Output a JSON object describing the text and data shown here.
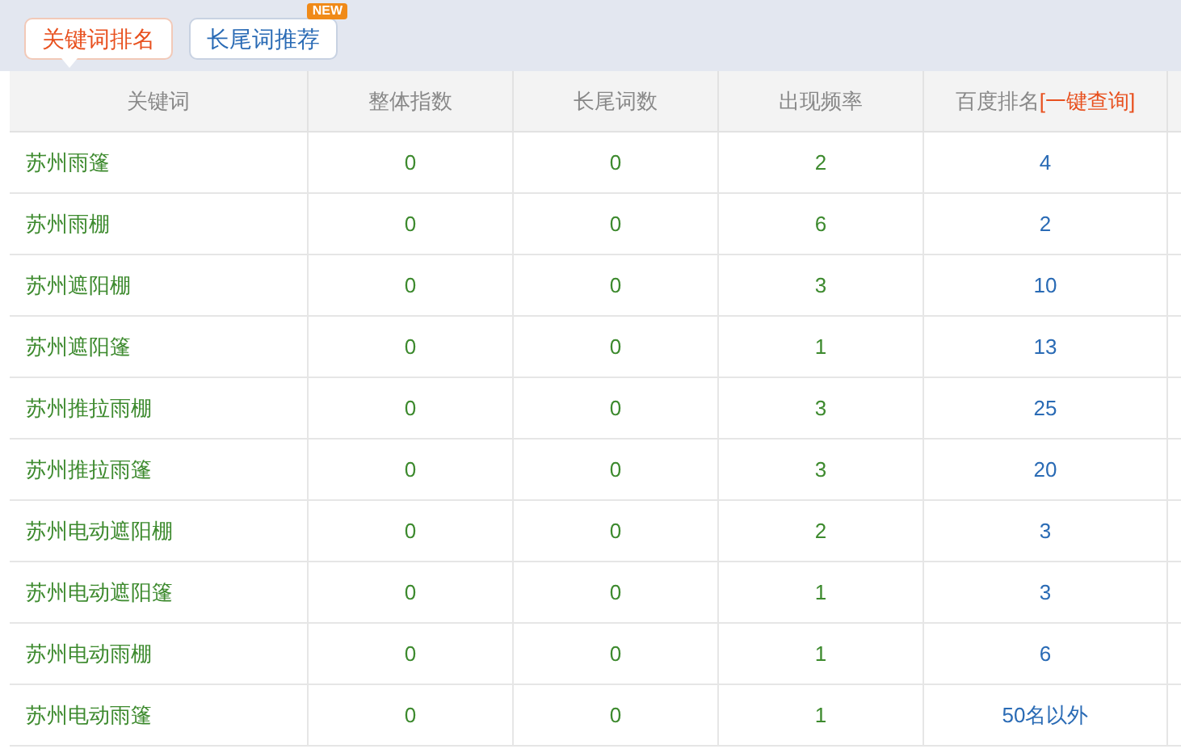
{
  "tabs": [
    {
      "label": "关键词排名",
      "selected": true
    },
    {
      "label": "长尾词推荐",
      "selected": false,
      "badge": "NEW"
    }
  ],
  "table": {
    "columns": [
      {
        "label": "关键词"
      },
      {
        "label": "整体指数"
      },
      {
        "label": "长尾词数"
      },
      {
        "label": "出现频率"
      },
      {
        "label": "百度排名",
        "link": "[一键查询]"
      }
    ],
    "rows": [
      [
        "苏州雨篷",
        "0",
        "0",
        "2",
        "4"
      ],
      [
        "苏州雨棚",
        "0",
        "0",
        "6",
        "2"
      ],
      [
        "苏州遮阳棚",
        "0",
        "0",
        "3",
        "10"
      ],
      [
        "苏州遮阳篷",
        "0",
        "0",
        "1",
        "13"
      ],
      [
        "苏州推拉雨棚",
        "0",
        "0",
        "3",
        "25"
      ],
      [
        "苏州推拉雨篷",
        "0",
        "0",
        "3",
        "20"
      ],
      [
        "苏州电动遮阳棚",
        "0",
        "0",
        "2",
        "3"
      ],
      [
        "苏州电动遮阳篷",
        "0",
        "0",
        "1",
        "3"
      ],
      [
        "苏州电动雨棚",
        "0",
        "0",
        "1",
        "6"
      ],
      [
        "苏州电动雨篷",
        "0",
        "0",
        "1",
        "50名以外"
      ]
    ]
  }
}
